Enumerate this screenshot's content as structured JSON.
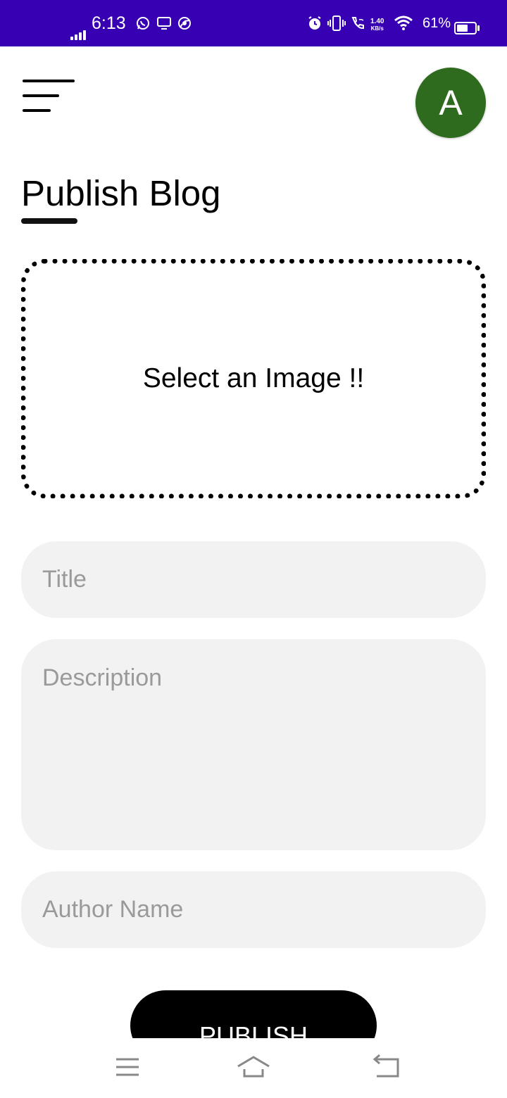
{
  "status_bar": {
    "time": "6:13",
    "speed_value": "1.40",
    "speed_unit": "KB/s",
    "battery_percent": "61%",
    "battery_level": 0.61,
    "icons": [
      "whatsapp-icon",
      "screen-cast-icon",
      "chrome-icon",
      "alarm-icon",
      "vibrate-icon",
      "wifi-calling-icon",
      "wifi-icon",
      "battery-icon"
    ]
  },
  "header": {
    "avatar_letter": "A",
    "avatar_color": "#2e6b1e"
  },
  "page": {
    "title": "Publish Blog"
  },
  "image_picker": {
    "label": "Select an Image !!"
  },
  "form": {
    "title_placeholder": "Title",
    "description_placeholder": "Description",
    "author_placeholder": "Author Name",
    "publish_label": "PUBLISH"
  },
  "colors": {
    "status_bar": "#3700b3",
    "input_background": "#f2f2f2",
    "button": "#000000"
  },
  "nav_bar": {
    "icons": [
      "recent-apps-icon",
      "home-icon",
      "back-icon"
    ]
  }
}
